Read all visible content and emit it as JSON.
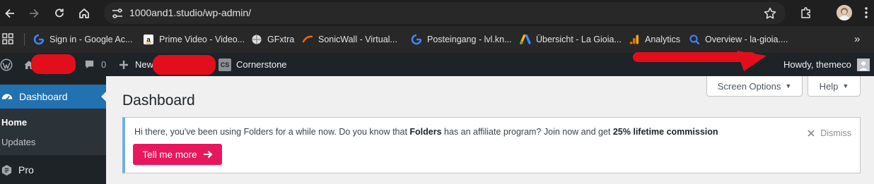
{
  "browser": {
    "url": "1000and1.studio/wp-admin/"
  },
  "bookmarks": [
    {
      "label": "Sign in - Google Ac...",
      "icon": "google-icon"
    },
    {
      "label": "Prime Video - Video...",
      "icon": "amazon-icon"
    },
    {
      "label": "GFxtra",
      "icon": "gfxtra-icon"
    },
    {
      "label": "SonicWall - Virtual...",
      "icon": "sonicwall-icon"
    },
    {
      "label": "Posteingang - lvl.kn...",
      "icon": "google-icon"
    },
    {
      "label": "Übersicht - La Gioia...",
      "icon": "google-ads-icon"
    },
    {
      "label": "Analytics",
      "icon": "analytics-icon"
    },
    {
      "label": "Overview - la-gioia....",
      "icon": "search-console-icon"
    }
  ],
  "adminbar": {
    "comments_count": "0",
    "new_label": "New",
    "cornerstone_badge": "CS",
    "cornerstone_label": "Cornerstone",
    "howdy": "Howdy, themeco"
  },
  "sidebar": {
    "dashboard": "Dashboard",
    "home": "Home",
    "updates": "Updates",
    "pro": "Pro"
  },
  "main": {
    "title": "Dashboard",
    "screen_options": "Screen Options",
    "help": "Help"
  },
  "notice": {
    "text_1": "Hi there, you've been using Folders for a while now. Do you know that ",
    "text_bold_1": "Folders",
    "text_2": " has an affiliate program? Join now and get ",
    "text_bold_2": "25% lifetime commission",
    "cta": "Tell me more",
    "dismiss": "Dismiss"
  },
  "colors": {
    "adminbar": "#1d2327",
    "accent": "#2271b1",
    "cta": "#e8175d",
    "notice_border": "#72aee6",
    "redaction": "#e30e1b"
  }
}
